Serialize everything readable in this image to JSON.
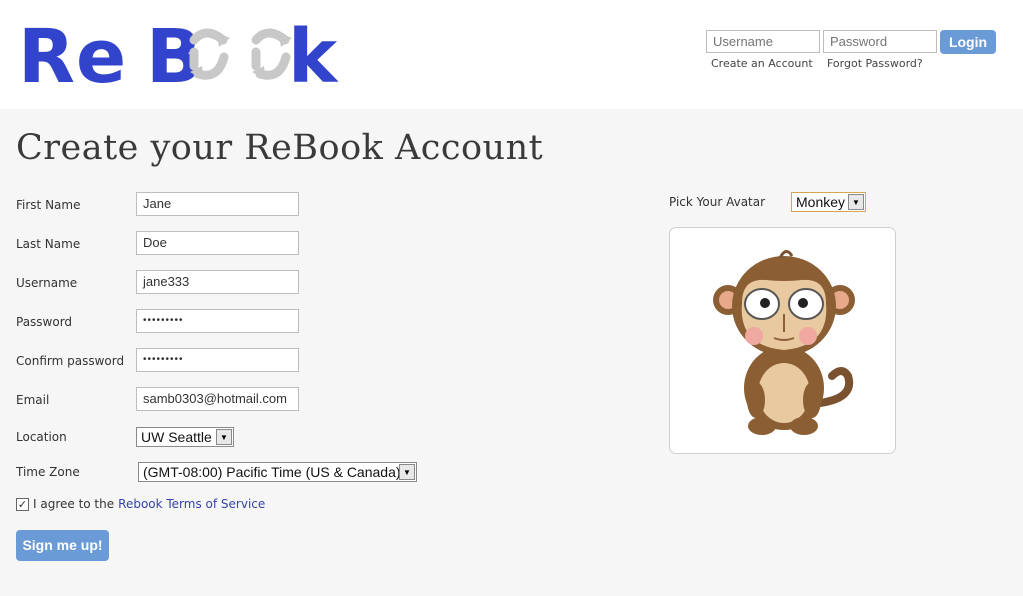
{
  "header": {
    "logo_text": "ReBook",
    "username_placeholder": "Username",
    "password_placeholder": "Password",
    "login_label": "Login",
    "create_account_link": "Create an Account",
    "forgot_password_link": "Forgot Password?"
  },
  "page": {
    "title": "Create your ReBook Account"
  },
  "form": {
    "first_name": {
      "label": "First Name",
      "value": "Jane"
    },
    "last_name": {
      "label": "Last Name",
      "value": "Doe"
    },
    "username": {
      "label": "Username",
      "value": "jane333"
    },
    "password": {
      "label": "Password",
      "value": "•••••••••"
    },
    "confirm_password": {
      "label": "Confirm password",
      "value": "•••••••••"
    },
    "email": {
      "label": "Email",
      "value": "samb0303@hotmail.com"
    },
    "location": {
      "label": "Location",
      "selected": "UW Seattle"
    },
    "time_zone": {
      "label": "Time Zone",
      "selected": "(GMT-08:00) Pacific Time (US & Canada)"
    },
    "terms": {
      "prefix": "I agree to the",
      "link": "Rebook Terms of Service",
      "checked": true
    },
    "submit_label": "Sign me up!"
  },
  "avatar": {
    "label": "Pick Your Avatar",
    "selected": "Monkey",
    "image": "monkey-avatar"
  },
  "colors": {
    "brand_blue": "#3344cc",
    "button_blue": "#6a9bd6",
    "link_blue": "#3344aa",
    "page_bg": "#f6f6f6"
  }
}
